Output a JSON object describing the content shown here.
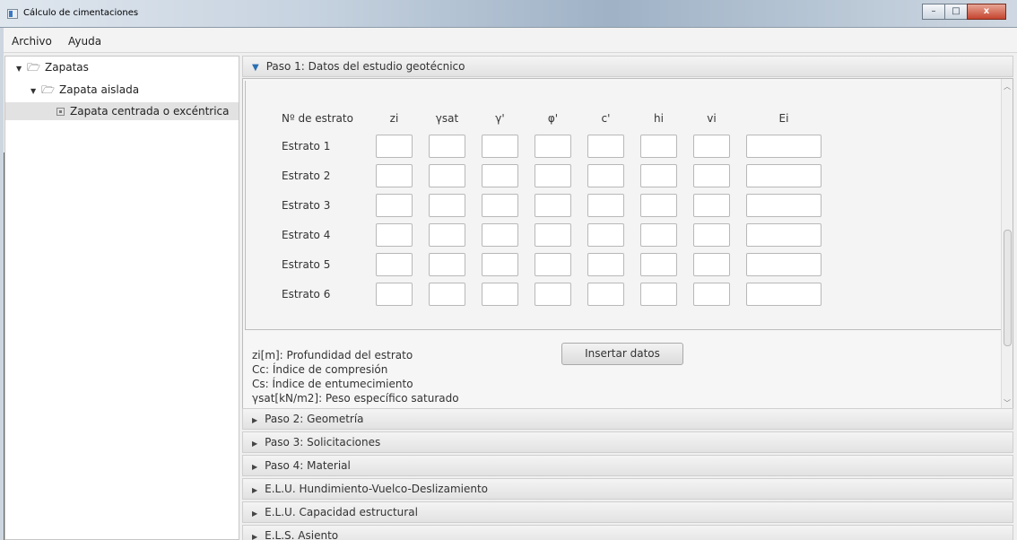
{
  "window": {
    "title": "Cálculo de cimentaciones",
    "min_label": "–",
    "max_label": "□",
    "close_label": "x"
  },
  "menu": [
    "Archivo",
    "Ayuda"
  ],
  "tree": {
    "root": "Zapatas",
    "child": "Zapata aislada",
    "leaf": "Zapata centrada o excéntrica"
  },
  "step1": {
    "header": "Paso 1: Datos del estudio geotécnico",
    "columns": [
      "Nº de estrato",
      "zi",
      "γsat",
      "γ'",
      "φ'",
      "c'",
      "hi",
      "vi",
      "Ei"
    ],
    "rows": [
      "Estrato 1",
      "Estrato 2",
      "Estrato 3",
      "Estrato 4",
      "Estrato 5",
      "Estrato 6"
    ],
    "insert_button": "Insertar datos",
    "legend": [
      "zi[m]: Profundidad del estrato",
      "Cc: Índice de compresión",
      "Cs: Índice de entumecimiento",
      "γsat[kN/m2]: Peso específico saturado"
    ]
  },
  "steps": [
    "Paso 2: Geometría",
    "Paso 3: Solicitaciones",
    "Paso 4: Material",
    "E.L.U. Hundimiento-Vuelco-Deslizamiento",
    "E.L.U. Capacidad estructural",
    "E.L.S. Asiento"
  ]
}
